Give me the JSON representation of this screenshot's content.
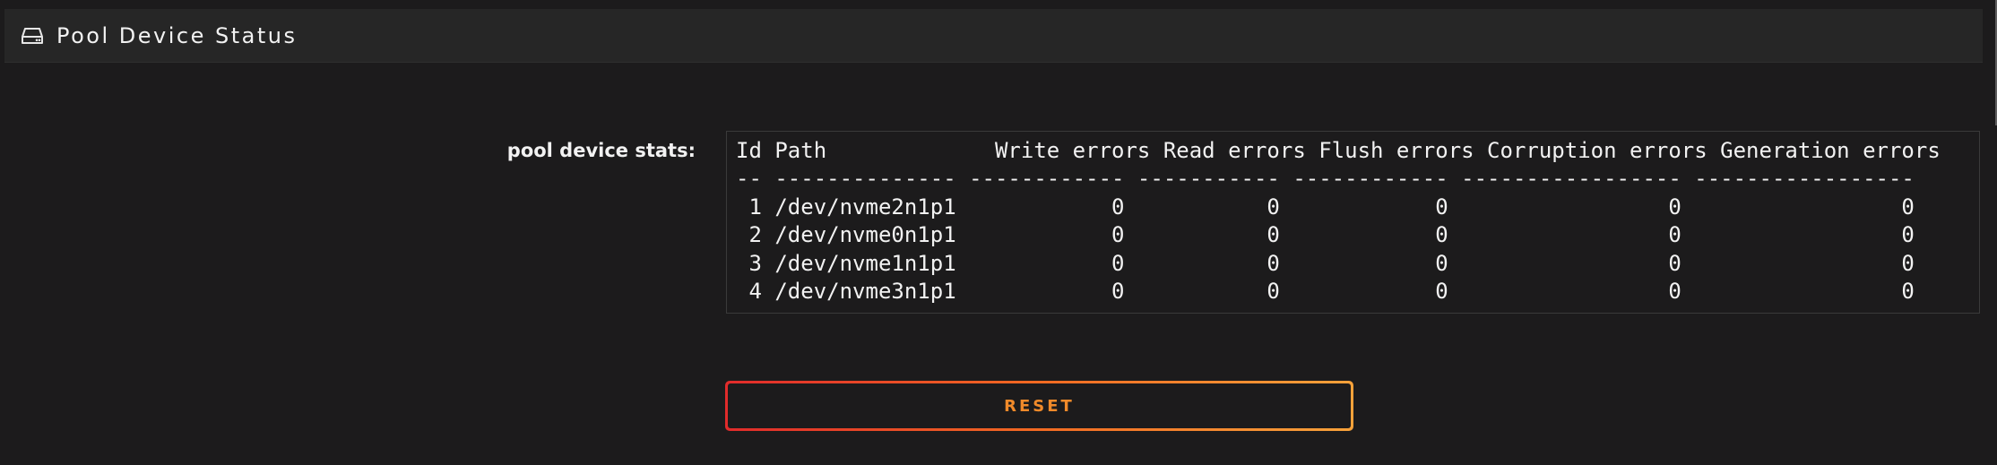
{
  "header": {
    "title": "Pool Device Status",
    "icon": "hard-drive-icon"
  },
  "stats": {
    "label": "pool device stats:",
    "output": "Id Path             Write errors Read errors Flush errors Corruption errors Generation errors\n-- -------------- ------------ ----------- ------------ ----------------- -----------------\n 1 /dev/nvme2n1p1            0           0            0                 0                 0\n 2 /dev/nvme0n1p1            0           0            0                 0                 0\n 3 /dev/nvme1n1p1            0           0            0                 0                 0\n 4 /dev/nvme3n1p1            0           0            0                 0                 0"
  },
  "actions": {
    "reset_label": "RESET"
  },
  "colors": {
    "background": "#1c1b1c",
    "header_background": "#262626",
    "accent_start": "#e12b2b",
    "accent_end": "#f7a23a",
    "reset_text": "#f08a2a"
  }
}
